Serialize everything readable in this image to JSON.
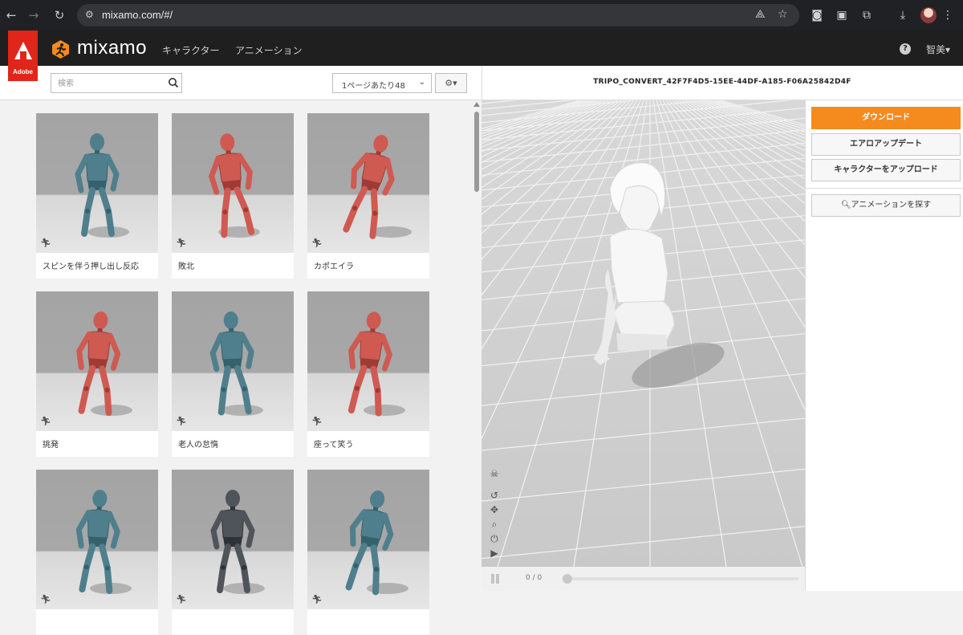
{
  "browser": {
    "url": "mixamo.com/#/",
    "back_icon": "←",
    "forward_icon": "→",
    "reload_icon": "↻"
  },
  "app": {
    "adobe_label": "Adobe",
    "brand": "mixamo",
    "nav": [
      "キャラクター",
      "アニメーション"
    ],
    "help": "?",
    "user": "智美▾"
  },
  "search": {
    "placeholder": "検索"
  },
  "per_page": {
    "selected": "1ページあたり48"
  },
  "cards": [
    {
      "label": "スピンを伴う押し出し反応",
      "color": "blue"
    },
    {
      "label": "敗北",
      "color": "red"
    },
    {
      "label": "カポエイラ",
      "color": "red"
    },
    {
      "label": "挑発",
      "color": "red"
    },
    {
      "label": "老人の怠惰",
      "color": "blue"
    },
    {
      "label": "座って笑う",
      "color": "red"
    },
    {
      "label": "",
      "color": "blue"
    },
    {
      "label": "",
      "color": "soldier"
    },
    {
      "label": "",
      "color": "blue"
    }
  ],
  "character": {
    "name": "TRIPO_CONVERT_42F7F4D5-15EE-44DF-A185-F06A25842D4F"
  },
  "playback": {
    "counter": "0 / 0"
  },
  "sidebar": {
    "download": "ダウンロード",
    "aero_update": "エアロアップデート",
    "upload_character": "キャラクターをアップロード",
    "find_animations": "アニメーションを探す"
  },
  "colors": {
    "accent": "#f58a1f",
    "adobe_red": "#e1251b",
    "header_bg": "#1f1f1f",
    "mannequin_blue": "#4f7f8c",
    "mannequin_red": "#cf5a52"
  }
}
